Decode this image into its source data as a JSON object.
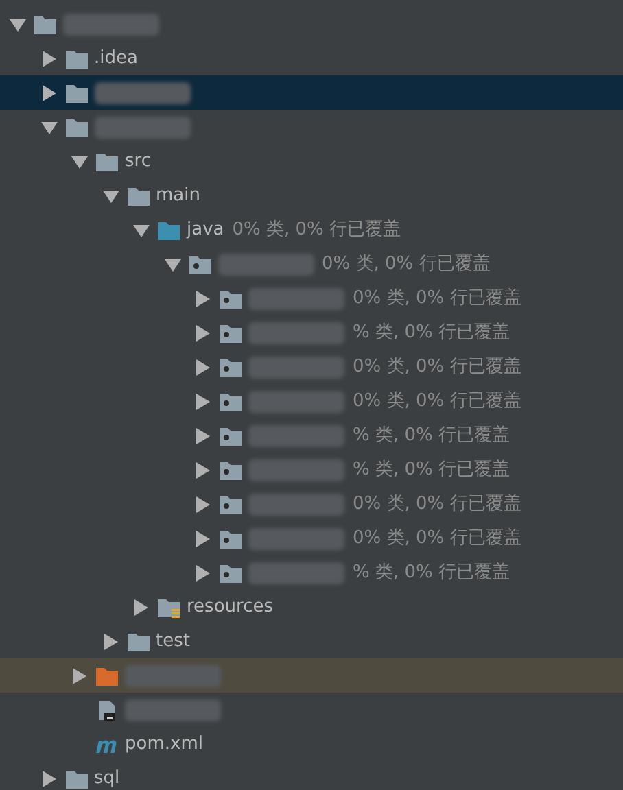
{
  "tree": [
    {
      "kind": "module",
      "name_hidden": true,
      "expanded": true,
      "selected": false,
      "highlighted": false,
      "children": [
        {
          "kind": "folder",
          "label": ".idea",
          "expanded": false,
          "selected": false,
          "highlighted": false
        },
        {
          "kind": "folder",
          "name_hidden": true,
          "expanded": false,
          "selected": true,
          "highlighted": false
        },
        {
          "kind": "folder",
          "name_hidden": true,
          "expanded": true,
          "selected": false,
          "highlighted": false,
          "children": [
            {
              "kind": "folder",
              "label": "src",
              "expanded": true,
              "selected": false,
              "highlighted": false,
              "children": [
                {
                  "kind": "folder",
                  "label": "main",
                  "expanded": true,
                  "selected": false,
                  "highlighted": false,
                  "children": [
                    {
                      "kind": "source-folder",
                      "label": "java",
                      "coverage": "0% 类, 0% 行已覆盖",
                      "expanded": true,
                      "selected": false,
                      "highlighted": false,
                      "children": [
                        {
                          "kind": "package",
                          "name_hidden": true,
                          "coverage": "0% 类, 0% 行已覆盖",
                          "expanded": true,
                          "selected": false,
                          "highlighted": false,
                          "children": [
                            {
                              "kind": "package",
                              "name_hidden": true,
                              "coverage": "0% 类, 0% 行已覆盖",
                              "expanded": false,
                              "selected": false,
                              "highlighted": false
                            },
                            {
                              "kind": "package",
                              "name_hidden": true,
                              "coverage": "% 类, 0% 行已覆盖",
                              "expanded": false,
                              "selected": false,
                              "highlighted": false
                            },
                            {
                              "kind": "package",
                              "name_hidden": true,
                              "coverage": "0% 类, 0% 行已覆盖",
                              "expanded": false,
                              "selected": false,
                              "highlighted": false
                            },
                            {
                              "kind": "package",
                              "name_hidden": true,
                              "coverage": "0% 类, 0% 行已覆盖",
                              "expanded": false,
                              "selected": false,
                              "highlighted": false
                            },
                            {
                              "kind": "package",
                              "name_hidden": true,
                              "coverage": "% 类, 0% 行已覆盖",
                              "expanded": false,
                              "selected": false,
                              "highlighted": false
                            },
                            {
                              "kind": "package",
                              "name_hidden": true,
                              "coverage": "% 类, 0% 行已覆盖",
                              "expanded": false,
                              "selected": false,
                              "highlighted": false
                            },
                            {
                              "kind": "package",
                              "name_hidden": true,
                              "coverage": "0% 类, 0% 行已覆盖",
                              "expanded": false,
                              "selected": false,
                              "highlighted": false
                            },
                            {
                              "kind": "package",
                              "name_hidden": true,
                              "coverage": "0% 类, 0% 行已覆盖",
                              "expanded": false,
                              "selected": false,
                              "highlighted": false
                            },
                            {
                              "kind": "package",
                              "name_hidden": true,
                              "coverage": "% 类, 0% 行已覆盖",
                              "expanded": false,
                              "selected": false,
                              "highlighted": false
                            }
                          ]
                        }
                      ]
                    },
                    {
                      "kind": "resources-folder",
                      "label": "resources",
                      "expanded": false,
                      "selected": false,
                      "highlighted": false
                    }
                  ]
                },
                {
                  "kind": "folder",
                  "label": "test",
                  "expanded": false,
                  "selected": false,
                  "highlighted": false
                }
              ]
            },
            {
              "kind": "excluded-folder",
              "name_hidden": true,
              "expanded": false,
              "selected": false,
              "highlighted": true
            },
            {
              "kind": "file",
              "name_hidden": true,
              "selected": false,
              "highlighted": false
            },
            {
              "kind": "maven",
              "label": "pom.xml",
              "selected": false,
              "highlighted": false
            }
          ]
        },
        {
          "kind": "folder",
          "label": "sql",
          "expanded": false,
          "selected": false,
          "highlighted": false
        }
      ]
    }
  ]
}
